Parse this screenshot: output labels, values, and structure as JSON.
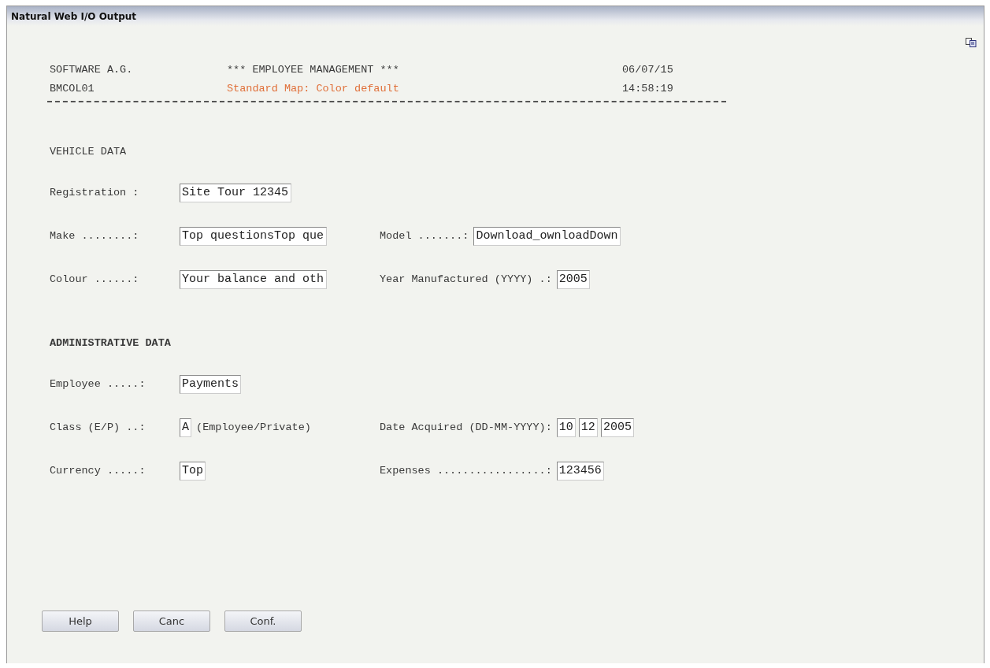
{
  "window": {
    "title": "Natural Web I/O Output"
  },
  "header": [
    {
      "left": "SOFTWARE A.G.",
      "center": "*** EMPLOYEE MANAGEMENT ***",
      "color": "#3a3a3a",
      "right": "06/07/15"
    },
    {
      "left": "BMCOL01",
      "center": "Standard Map: Color default",
      "color": "#e0703a",
      "right": "14:58:19"
    }
  ],
  "sections": [
    {
      "heading": "VEHICLE DATA",
      "bold": false,
      "rows": [
        {
          "left": [
            {
              "kind": "label",
              "text": "Registration :"
            },
            {
              "kind": "field",
              "value": "Site Tour 12345"
            }
          ]
        },
        {
          "left": [
            {
              "kind": "label",
              "text": "Make ........:"
            },
            {
              "kind": "field",
              "value": "Top questionsTop que"
            }
          ],
          "right": [
            {
              "kind": "label",
              "text": "Model .......:"
            },
            {
              "kind": "field",
              "value": "Download_ownloadDown"
            }
          ]
        },
        {
          "left": [
            {
              "kind": "label",
              "text": "Colour ......:"
            },
            {
              "kind": "field",
              "value": "Your balance and oth"
            }
          ],
          "right": [
            {
              "kind": "label",
              "text": "Year Manufactured (YYYY) .:"
            },
            {
              "kind": "field",
              "value": "2005"
            }
          ]
        }
      ]
    },
    {
      "heading": "ADMINISTRATIVE DATA",
      "bold": true,
      "rows": [
        {
          "left": [
            {
              "kind": "label",
              "text": "Employee .....:"
            },
            {
              "kind": "field",
              "value": "Payments"
            }
          ]
        },
        {
          "left": [
            {
              "kind": "label",
              "text": "Class (E/P) ..:"
            },
            {
              "kind": "field",
              "value": "A"
            },
            {
              "kind": "text",
              "text": "(Employee/Private)"
            }
          ],
          "right": [
            {
              "kind": "label",
              "text": "Date Acquired (DD-MM-YYYY):"
            },
            {
              "kind": "field",
              "value": "10"
            },
            {
              "kind": "field",
              "value": "12"
            },
            {
              "kind": "field",
              "value": "2005"
            }
          ]
        },
        {
          "left": [
            {
              "kind": "label",
              "text": "Currency .....:"
            },
            {
              "kind": "field",
              "value": "Top"
            }
          ],
          "right": [
            {
              "kind": "label",
              "text": "Expenses .................:"
            },
            {
              "kind": "field",
              "value": "123456"
            }
          ]
        }
      ]
    }
  ],
  "buttons": [
    "Help",
    "Canc",
    "Conf."
  ]
}
